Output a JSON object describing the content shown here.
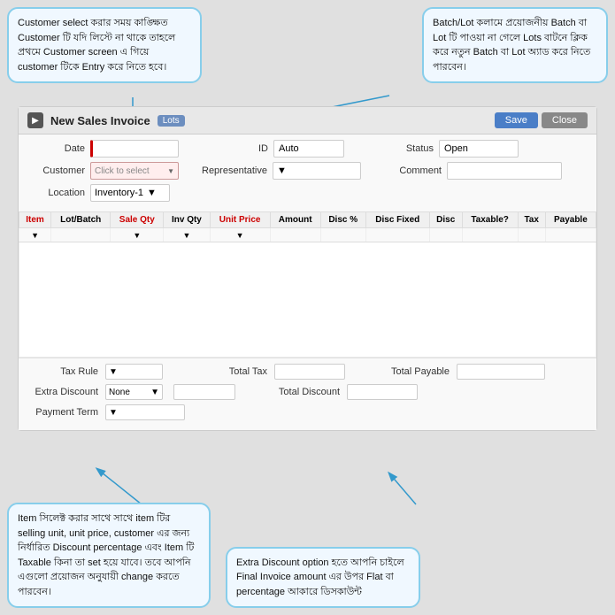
{
  "tooltips": {
    "top_left": {
      "text": "Customer select করার সময় কাঙ্ক্ষিত Customer টি যদি লিস্টে না থাকে তাহলে প্রথমে Customer screen এ গিয়ে customer টিকে Entry করে নিতে হবে।"
    },
    "top_right": {
      "text": "Batch/Lot কলামে প্রয়োজনীয় Batch বা Lot টি পাওয়া না গেলে Lots বাটনে ক্লিক করে নতুন Batch বা Lot অ্যাড করে নিতে পারবেন।"
    },
    "bottom_left": {
      "text": "Item সিলেক্ট করার সাথে সাথে item টির selling unit, unit price, customer এর জন্য নির্ধারিত Discount percentage এবং Item টি Taxable কিনা তা set হয়ে যাবে। তবে আপনি এগুলো প্রয়োজন অনুযায়ী change করতে পারবেন।"
    },
    "bottom_right": {
      "text": "Extra Discount option হতে আপনি চাইলে Final Invoice amount এর উপর Flat বা percentage আকারে ডিসকাউন্ট"
    }
  },
  "invoice": {
    "header": {
      "title": "New Sales Invoice",
      "badge": "Lots",
      "save_label": "Save",
      "close_label": "Close"
    },
    "fields": {
      "date_label": "Date",
      "id_label": "ID",
      "id_value": "Auto",
      "status_label": "Status",
      "status_value": "Open",
      "customer_label": "Customer",
      "customer_placeholder": "Click to select",
      "representative_label": "Representative",
      "comment_label": "Comment",
      "location_label": "Location",
      "location_value": "Inventory-1"
    },
    "table": {
      "columns": [
        "Item",
        "Lot/Batch",
        "Sale Qty",
        "Inv Qty",
        "Unit Price",
        "Amount",
        "Disc %",
        "Disc Fixed",
        "Disc",
        "Taxable?",
        "Tax",
        "Payable"
      ]
    },
    "bottom": {
      "tax_rule_label": "Tax Rule",
      "total_tax_label": "Total Tax",
      "total_payable_label": "Total Payable",
      "extra_discount_label": "Extra Discount",
      "extra_discount_option": "None",
      "total_discount_label": "Total Discount",
      "payment_term_label": "Payment Term"
    }
  }
}
